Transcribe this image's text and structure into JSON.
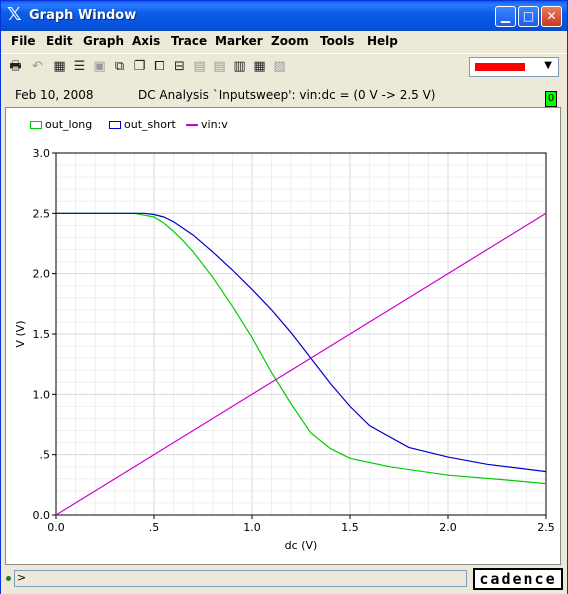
{
  "window": {
    "title": "Graph Window"
  },
  "menu": [
    "File",
    "Edit",
    "Graph",
    "Axis",
    "Trace",
    "Marker",
    "Zoom",
    "Tools",
    "Help"
  ],
  "toolbar": {
    "icons": [
      "print-icon",
      "undo-icon",
      "grid-icon",
      "list-icon",
      "frame-icon",
      "split-icon",
      "strip-icon",
      "window-icon",
      "stack-icon",
      "bus-icon",
      "calculator-icon",
      "table-icon",
      "eye-icon"
    ],
    "trace_color": "#ff0000"
  },
  "info": {
    "date": "Feb 10, 2008",
    "analysis": "DC Analysis `Inputsweep': vin:dc = (0 V -> 2.5 V)",
    "badge": "0"
  },
  "status": {
    "prompt": ">",
    "logo": "cadence"
  },
  "chart_data": {
    "type": "line",
    "xlabel": "dc (V)",
    "ylabel": "V (V)",
    "xlim": [
      0,
      2.5
    ],
    "ylim": [
      0,
      3.0
    ],
    "xticks": [
      "0.0",
      ".5",
      "1.0",
      "1.5",
      "2.0",
      "2.5"
    ],
    "yticks": [
      "0.0",
      ".5",
      "1.0",
      "1.5",
      "2.0",
      "2.5",
      "3.0"
    ],
    "grid": true,
    "legend_position": "top-left",
    "series": [
      {
        "name": "out_long",
        "color": "#00cc00",
        "x": [
          0,
          0.3,
          0.4,
          0.5,
          0.55,
          0.6,
          0.65,
          0.7,
          0.8,
          0.9,
          1.0,
          1.1,
          1.2,
          1.3,
          1.4,
          1.5,
          1.7,
          2.0,
          2.3,
          2.5
        ],
        "y": [
          2.5,
          2.5,
          2.5,
          2.47,
          2.42,
          2.35,
          2.27,
          2.18,
          1.97,
          1.73,
          1.47,
          1.18,
          0.92,
          0.68,
          0.55,
          0.47,
          0.4,
          0.33,
          0.29,
          0.26
        ]
      },
      {
        "name": "out_short",
        "color": "#0000cc",
        "x": [
          0,
          0.35,
          0.45,
          0.5,
          0.55,
          0.6,
          0.7,
          0.8,
          0.9,
          1.0,
          1.1,
          1.2,
          1.3,
          1.4,
          1.5,
          1.6,
          1.8,
          2.0,
          2.2,
          2.4,
          2.5
        ],
        "y": [
          2.5,
          2.5,
          2.5,
          2.49,
          2.47,
          2.43,
          2.32,
          2.18,
          2.03,
          1.87,
          1.7,
          1.51,
          1.3,
          1.09,
          0.9,
          0.74,
          0.56,
          0.48,
          0.42,
          0.38,
          0.36
        ]
      },
      {
        "name": "vin:v",
        "color": "#cc00cc",
        "x": [
          0,
          2.5
        ],
        "y": [
          0,
          2.5
        ]
      }
    ]
  }
}
